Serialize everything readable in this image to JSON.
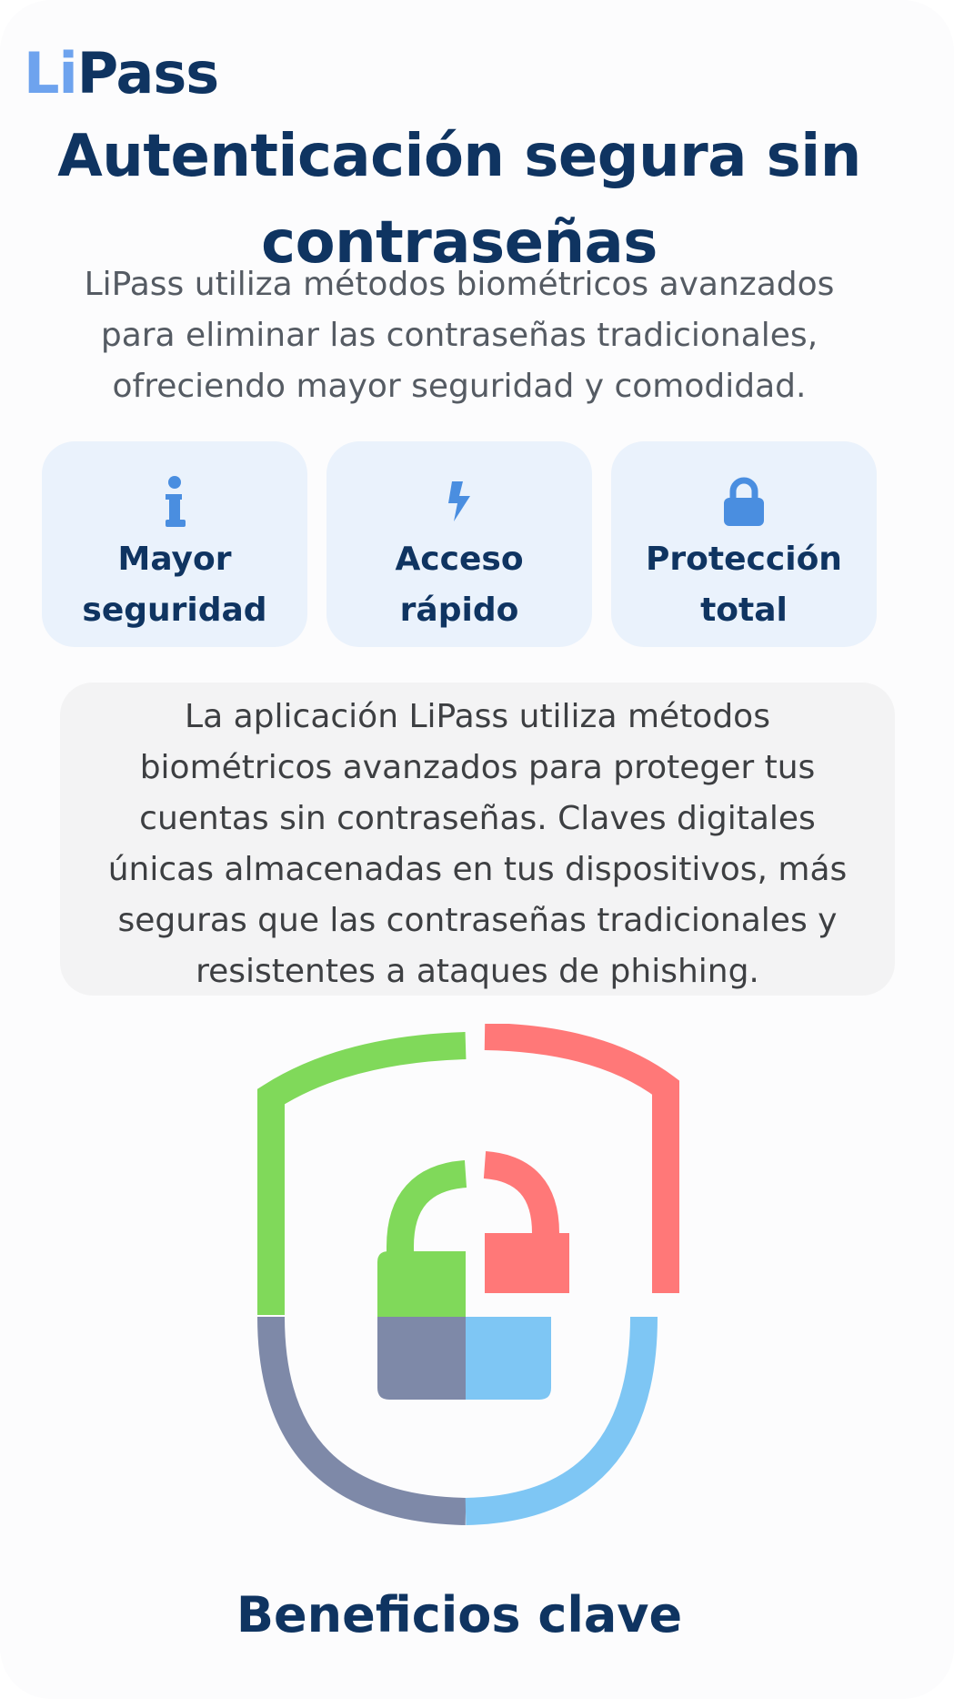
{
  "header": {
    "logo_part1": "Li",
    "logo_part2": "Pass",
    "brand_colors": {
      "li": "#6ea3ee",
      "pass": "#0f3461"
    }
  },
  "hero": {
    "title": "Autenticación segura sin contraseñas",
    "subtitle": "LiPass utiliza métodos biométricos avanzados para eliminar las contraseñas tradicionales, ofreciendo mayor seguridad y comodidad."
  },
  "features": [
    {
      "icon": "info-icon",
      "label": "Mayor seguridad"
    },
    {
      "icon": "lightning-bolt-icon",
      "label": "Acceso rápido"
    },
    {
      "icon": "lock-icon",
      "label": "Protección total"
    }
  ],
  "description": "La aplicación LiPass utiliza métodos biométricos avanzados para proteger tus cuentas sin contraseñas. Claves digitales únicas almacenadas en tus dispositivos, más seguras que las contraseñas tradicionales y resistentes a ataques de phishing.",
  "illustration": {
    "icon": "shield-lock-illustration",
    "colors": {
      "green": "#80d95a",
      "red": "#ff7878",
      "slate": "#7e89a8",
      "blue": "#7ec6f4"
    }
  },
  "benefits": {
    "title": "Beneficios clave"
  },
  "theme": {
    "accent": "#4a8ee0",
    "card_bg": "#eaf2fc",
    "heading": "#0f3461"
  }
}
